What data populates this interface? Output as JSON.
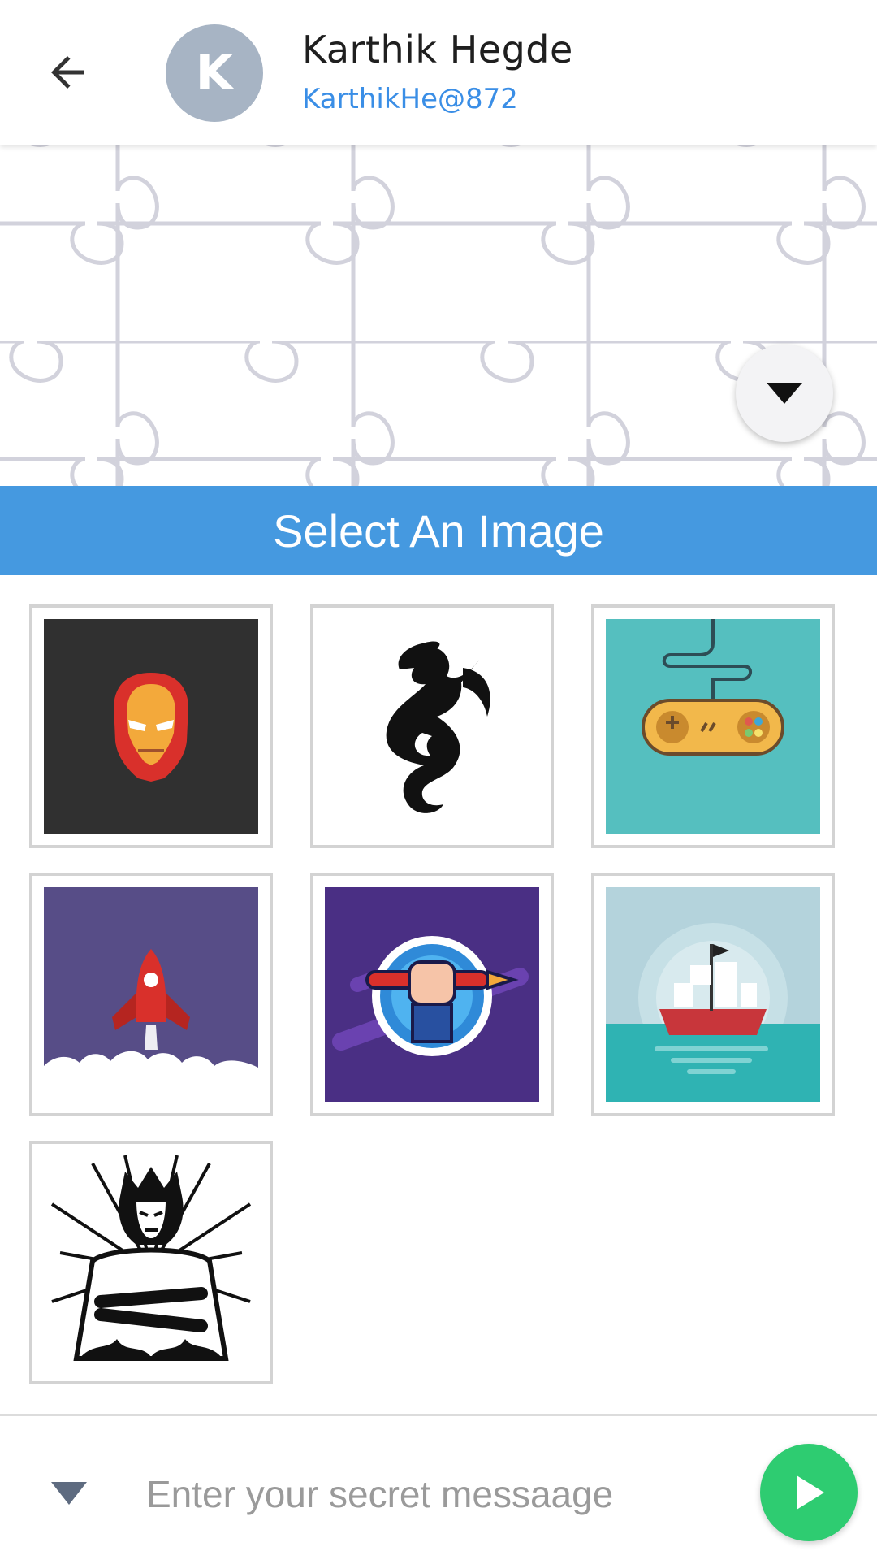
{
  "header": {
    "back_icon": "arrow-left-icon",
    "avatar_initial": "K",
    "contact_name": "Karthik Hegde",
    "contact_handle": "KarthikHe@872"
  },
  "chat": {
    "background_pattern": "jigsaw-puzzle",
    "scroll_button_icon": "caret-down-icon"
  },
  "picker": {
    "title": "Select An Image",
    "images": [
      {
        "name": "iron-man-helmet",
        "background": "#303030"
      },
      {
        "name": "black-dragon",
        "background": "#ffffff"
      },
      {
        "name": "game-controller",
        "background": "#55bfbf"
      },
      {
        "name": "rocket-launch",
        "background": "#574d87"
      },
      {
        "name": "fist-holding-pen",
        "background": "#4a2f84"
      },
      {
        "name": "sailing-ship",
        "background": "#b4d3dc"
      },
      {
        "name": "wolverine-sketch",
        "background": "#ffffff"
      }
    ]
  },
  "composer": {
    "toggle_icon": "caret-down-icon",
    "placeholder": "Enter your secret messaage",
    "send_icon": "play-icon"
  },
  "colors": {
    "accent": "#4599e0",
    "send": "#2ecc71",
    "avatar": "#a7b4c4",
    "handle": "#3a8ee6"
  }
}
